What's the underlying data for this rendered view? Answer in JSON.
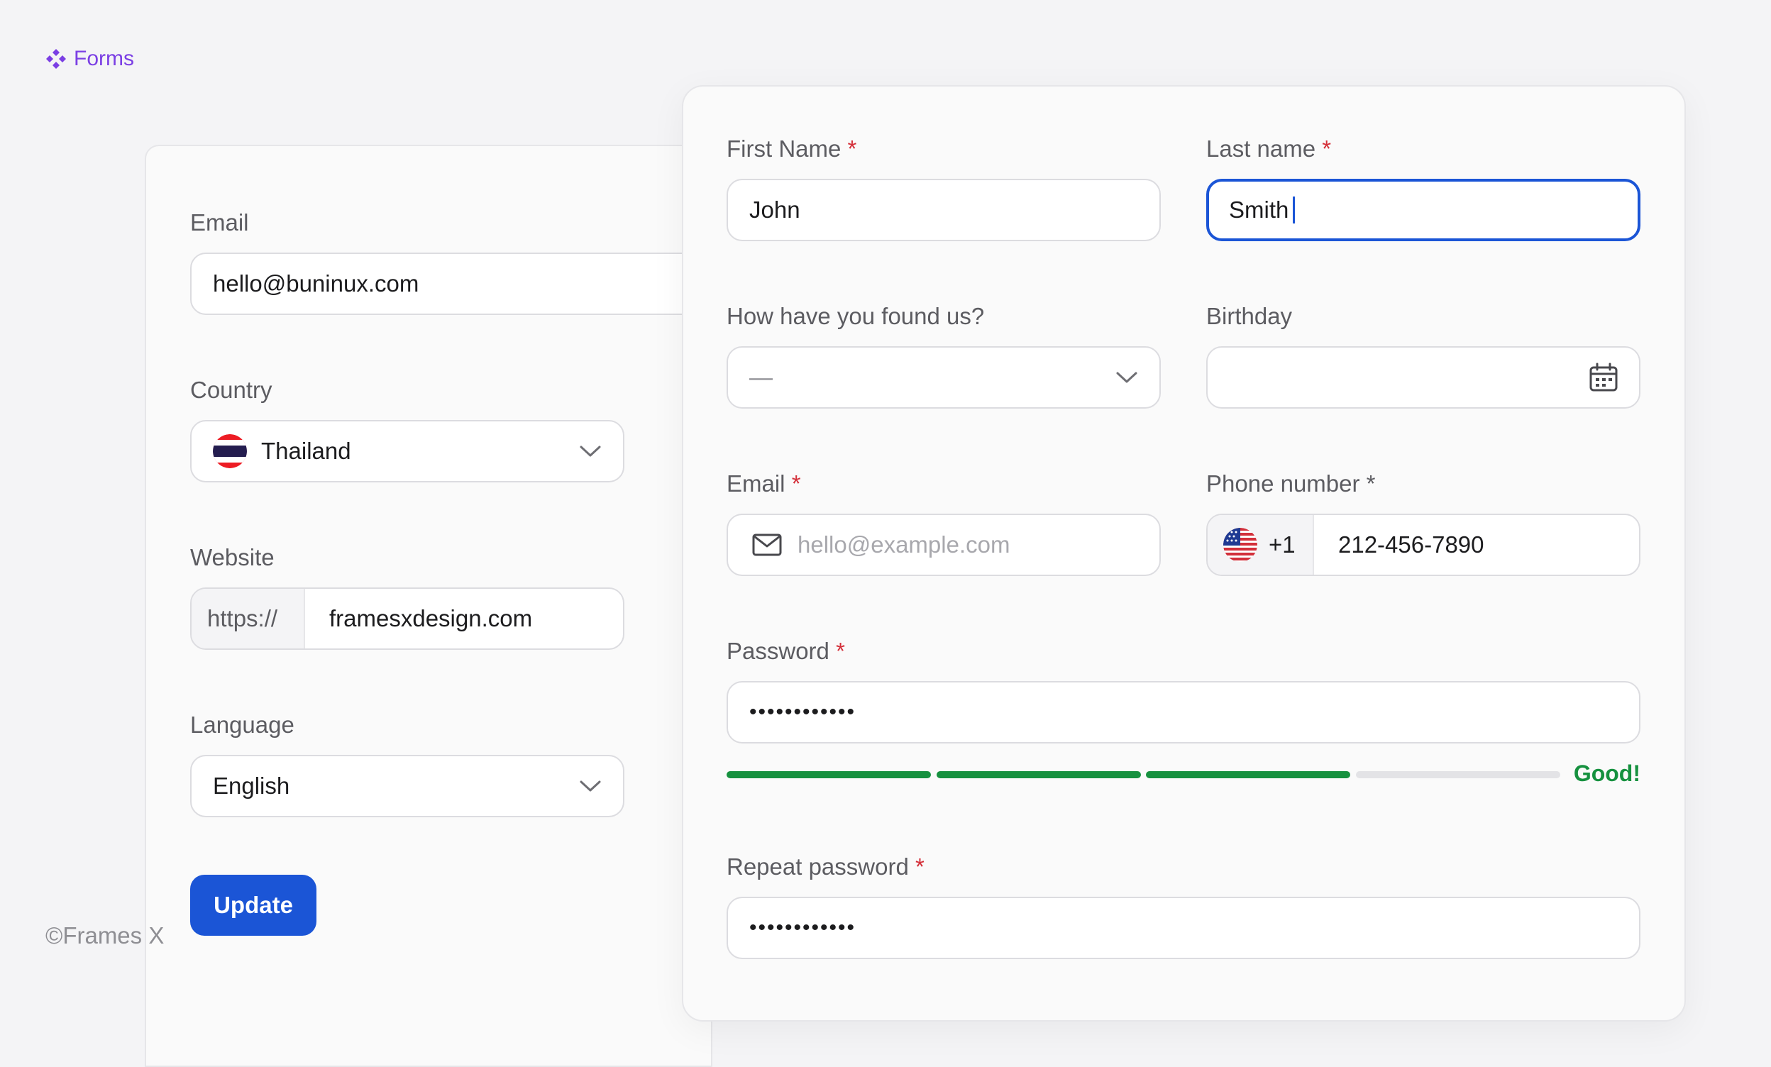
{
  "brand": {
    "label": "Forms",
    "icon": "diamond-cluster-icon",
    "color": "#7b3fe4"
  },
  "footer": {
    "copyright": "©Frames X"
  },
  "left_form": {
    "email": {
      "label": "Email",
      "value": "hello@buninux.com"
    },
    "country": {
      "label": "Country",
      "value": "Thailand",
      "flag_icon": "thailand-flag-icon"
    },
    "website": {
      "label": "Website",
      "prefix": "https://",
      "value": "framesxdesign.com"
    },
    "language": {
      "label": "Language",
      "value": "English"
    },
    "update_label": "Update"
  },
  "right_form": {
    "first_name": {
      "label": "First Name",
      "required": "*",
      "value": "John"
    },
    "last_name": {
      "label": "Last name",
      "required": "*",
      "value": "Smith"
    },
    "found_us": {
      "label": "How have you found us?",
      "value": "—"
    },
    "birthday": {
      "label": "Birthday",
      "value": ""
    },
    "email": {
      "label": "Email",
      "required": "*",
      "placeholder": "hello@example.com"
    },
    "phone": {
      "label": "Phone number",
      "required": "*",
      "code": "+1",
      "value": "212-456-7890",
      "flag_icon": "us-flag-icon"
    },
    "password": {
      "label": "Password",
      "required": "*",
      "value": "••••••••••••",
      "strength_label": "Good!",
      "strength_segments_filled": 3,
      "strength_segments_total": 4
    },
    "repeat_password": {
      "label": "Repeat password",
      "required": "*",
      "value": "••••••••••••"
    }
  },
  "colors": {
    "accent": "#1b55d6",
    "required": "#d4303a",
    "strength_good": "#16913f",
    "strength_empty": "#e3e3e6"
  }
}
